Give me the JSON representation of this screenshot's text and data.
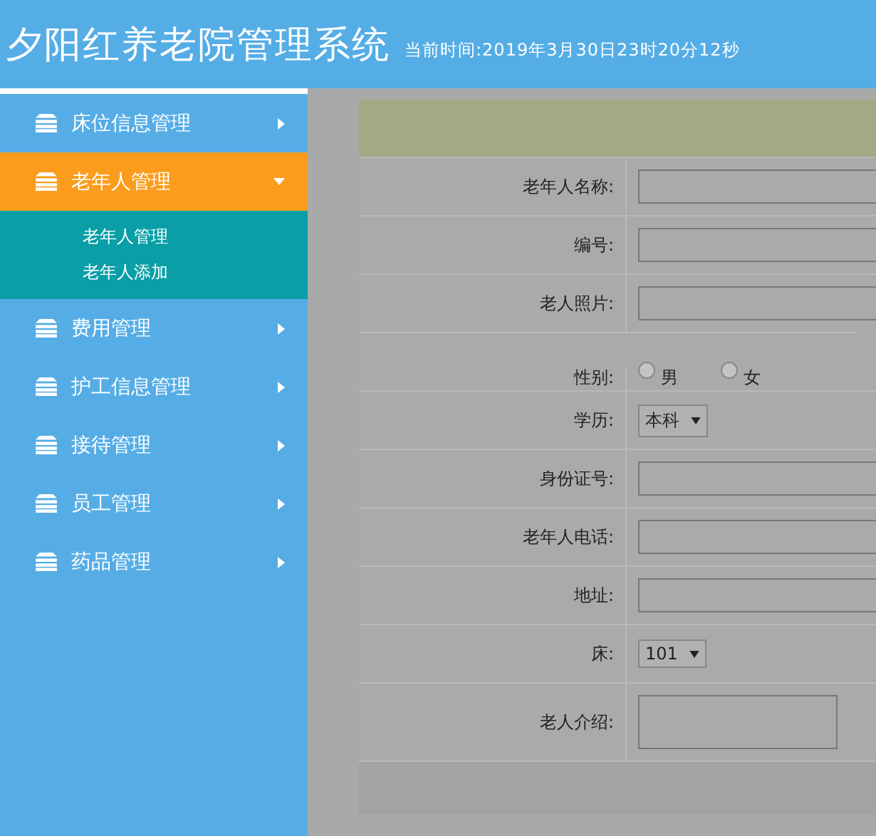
{
  "header": {
    "title": "夕阳红养老院管理系统",
    "clock": "当前时间:2019年3月30日23时20分12秒"
  },
  "sidebar": {
    "items": [
      {
        "label": "床位信息管理",
        "expanded": false
      },
      {
        "label": "老年人管理",
        "expanded": true,
        "children": [
          {
            "label": "老年人管理"
          },
          {
            "label": "老年人添加"
          }
        ]
      },
      {
        "label": "费用管理",
        "expanded": false
      },
      {
        "label": "护工信息管理",
        "expanded": false
      },
      {
        "label": "接待管理",
        "expanded": false
      },
      {
        "label": "员工管理",
        "expanded": false
      },
      {
        "label": "药品管理",
        "expanded": false
      }
    ]
  },
  "form": {
    "fields": [
      {
        "kind": "text",
        "label": "老年人名称:"
      },
      {
        "kind": "text",
        "label": "编号:"
      },
      {
        "kind": "text",
        "label": "老人照片:"
      },
      {
        "kind": "radio",
        "label": "性别:",
        "options": [
          {
            "label": "男",
            "selected": false
          },
          {
            "label": "女",
            "selected": false
          }
        ]
      },
      {
        "kind": "select",
        "label": "学历:",
        "value": "本科"
      },
      {
        "kind": "text",
        "label": "身份证号:"
      },
      {
        "kind": "text",
        "label": "老年人电话:"
      },
      {
        "kind": "text",
        "label": "地址:"
      },
      {
        "kind": "select",
        "label": "床:",
        "value": "101"
      },
      {
        "kind": "textarea",
        "label": "老人介绍:"
      }
    ]
  }
}
